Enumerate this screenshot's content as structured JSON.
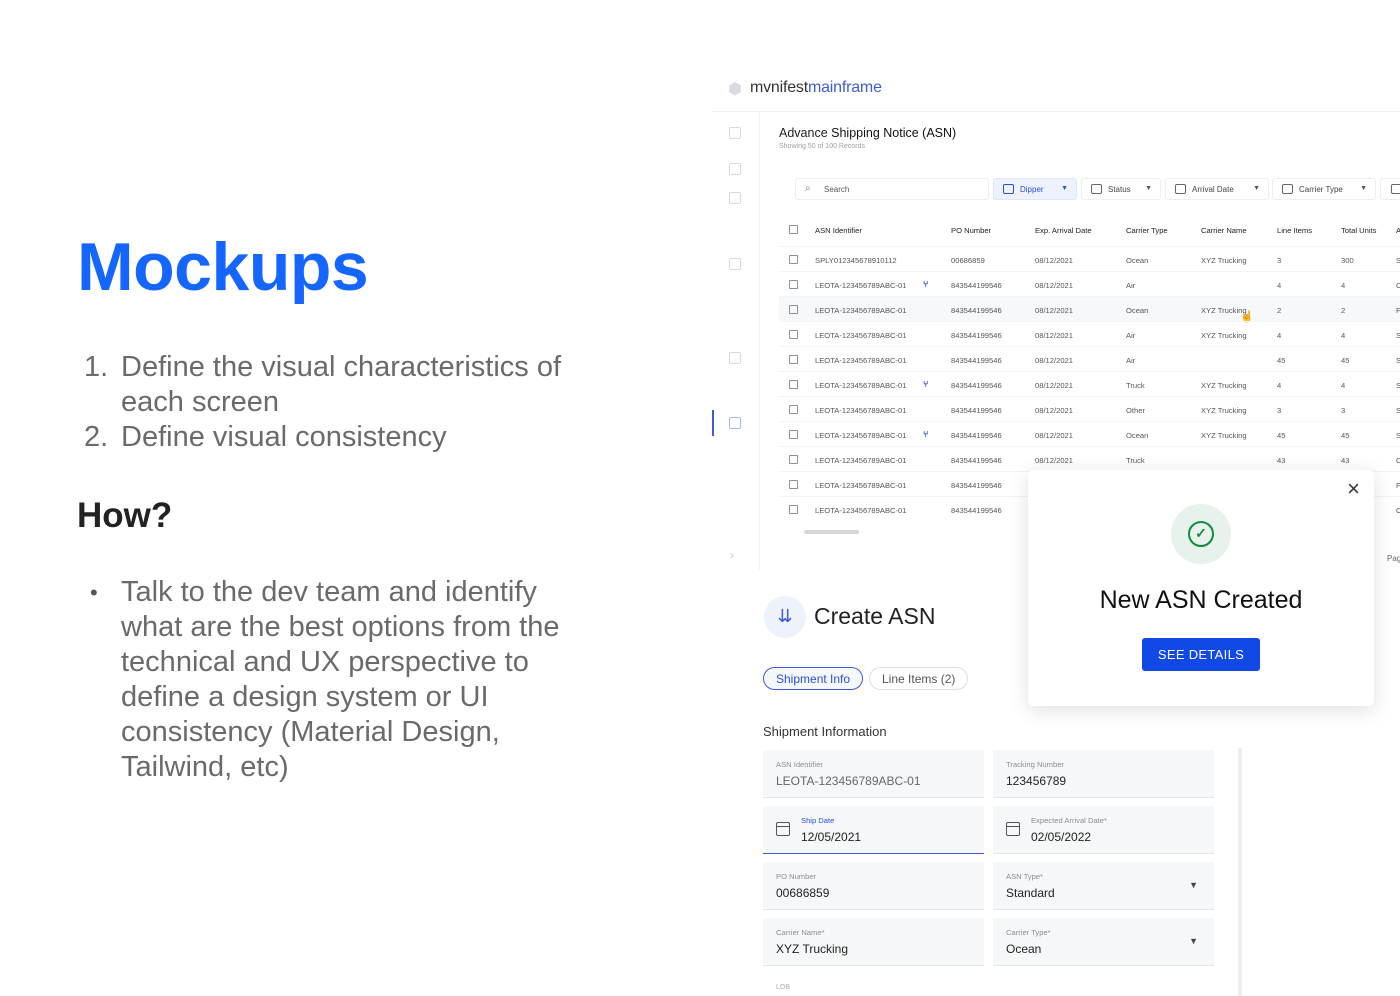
{
  "slide": {
    "title": "Mockups",
    "goals": [
      {
        "num": "1.",
        "text": "Define the visual characteristics of each screen"
      },
      {
        "num": "2.",
        "text": "Define visual consistency"
      }
    ],
    "how_title": "How?",
    "how_items": [
      {
        "bullet": "•",
        "text": "Talk to the dev team and identify what are the best options from the technical and UX perspective to define a design system or UI consistency (Material Design, Tailwind, etc)"
      }
    ]
  },
  "app": {
    "logo": {
      "part1": "mvnifest",
      "part2": "mainframe"
    },
    "page_title_prefix": "Advance",
    "page_title_rest": " Shipping Notice (ASN)",
    "page_subtitle": "Showing 50 of 100 Records",
    "toolbar": {
      "search_placeholder": "Search",
      "filters": [
        {
          "label": "Dipper",
          "icon": "store-icon",
          "active": true
        },
        {
          "label": "Status",
          "icon": "sliders-icon",
          "active": false
        },
        {
          "label": "Arrival Date",
          "icon": "calendar-icon",
          "active": false
        },
        {
          "label": "Carrier Type",
          "icon": "truck-icon",
          "active": false
        }
      ]
    },
    "table": {
      "headers": [
        "ASN Identifier",
        "PO Number",
        "Exp. Arrival Date",
        "Carrier Type",
        "Carrier Name",
        "Line Items",
        "Total Units",
        "A"
      ],
      "rows": [
        [
          "SPLY012345678910112",
          "00686859",
          "08/12/2021",
          "Ocean",
          "XYZ Trucking",
          "3",
          "300",
          "S"
        ],
        [
          "LEOTA-123456789ABC-01",
          "843544199546",
          "08/12/2021",
          "Air",
          "",
          "4",
          "4",
          "C"
        ],
        [
          "LEOTA-123456789ABC-01",
          "843544199546",
          "08/12/2021",
          "Ocean",
          "XYZ Trucking",
          "2",
          "2",
          "F"
        ],
        [
          "LEOTA-123456789ABC-01",
          "843544199546",
          "08/12/2021",
          "Air",
          "XYZ Trucking",
          "4",
          "4",
          "S"
        ],
        [
          "LEOTA-123456789ABC-01",
          "843544199546",
          "08/12/2021",
          "Air",
          "",
          "45",
          "45",
          "S"
        ],
        [
          "LEOTA-123456789ABC-01",
          "843544199546",
          "08/12/2021",
          "Truck",
          "XYZ Trucking",
          "4",
          "4",
          "S"
        ],
        [
          "LEOTA-123456789ABC-01",
          "843544199546",
          "08/12/2021",
          "Other",
          "XYZ Trucking",
          "3",
          "3",
          "S"
        ],
        [
          "LEOTA-123456789ABC-01",
          "843544199546",
          "08/12/2021",
          "Ocean",
          "XYZ Trucking",
          "45",
          "45",
          "S"
        ],
        [
          "LEOTA-123456789ABC-01",
          "843544199546",
          "08/12/2021",
          "Truck",
          "",
          "43",
          "43",
          "C"
        ],
        [
          "LEOTA-123456789ABC-01",
          "843544199546",
          "",
          "",
          "",
          "",
          "",
          "F"
        ],
        [
          "LEOTA-123456789ABC-01",
          "843544199546",
          "",
          "",
          "",
          "",
          "",
          "C"
        ]
      ],
      "split_rows": [
        1,
        5,
        7
      ],
      "pagination": "Pag"
    }
  },
  "create_asn": {
    "title": "Create ASN",
    "tabs": [
      "Shipment Info",
      "Line Items (2)"
    ],
    "section_title": "Shipment Information",
    "fields": [
      {
        "label": "ASN Identifier",
        "value": "LEOTA-123456789ABC-01"
      },
      {
        "label": "Tracking Number",
        "value": "123456789"
      },
      {
        "label": "Ship Date",
        "value": "12/05/2021"
      },
      {
        "label": "Expected Arrival Date*",
        "value": "02/05/2022"
      },
      {
        "label": "PO Number",
        "value": "00686859"
      },
      {
        "label": "ASN Type*",
        "value": "Standard"
      },
      {
        "label": "Carrier Name*",
        "value": "XYZ Trucking"
      },
      {
        "label": "Carrier Type*",
        "value": "Ocean"
      }
    ],
    "lob_label": "LOB"
  },
  "modal": {
    "title": "New ASN Created",
    "button": "SEE DETAILS",
    "close": "×",
    "check": "✓"
  },
  "colors": {
    "accent": "#1565ff",
    "primary_button": "#1049e6",
    "success": "#138a3e"
  }
}
